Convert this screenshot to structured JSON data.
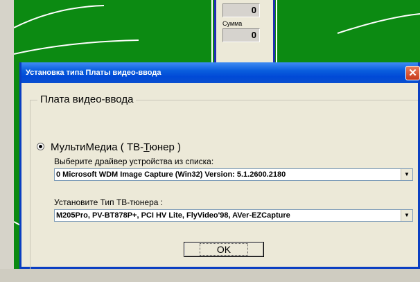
{
  "background": {
    "counter_top_value": "0",
    "sum_label": "Сумма",
    "sum_value": "0",
    "field_color": "#0c8a12"
  },
  "dialog": {
    "title": "Установка типа Платы видео-ввода",
    "close_icon": "close-x-icon",
    "group_title": "Плата видео-ввода",
    "radio": {
      "label_before": "МультиМедиа ( ТВ-",
      "label_underlined": "Т",
      "label_after": "юнер )",
      "checked": true
    },
    "driver_label": "Выберите драйвер устройства из списка:",
    "driver_value": "0 Microsoft WDM Image Capture (Win32)  Version:  5.1.2600.2180",
    "tuner_label": "Установите Тип ТВ-тюнера :",
    "tuner_value": "M205Pro, PV-BT878P+, PCI HV Lite, FlyVideo'98, AVer-EZCapture",
    "ok_label": "OK"
  },
  "colors": {
    "titlebar": "#0a5ddd",
    "dialog_face": "#ece9d8",
    "close_button": "#c8391a"
  }
}
